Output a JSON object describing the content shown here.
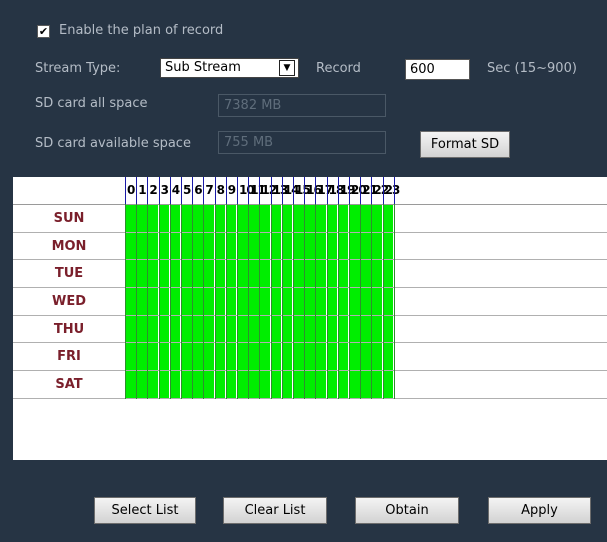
{
  "enable_label": "Enable the plan of record",
  "enable_checked": true,
  "stream_label": "Stream Type:",
  "stream_value": "Sub Stream",
  "record_label": "Record",
  "record_value": "600",
  "sec_label": "Sec (15~900)",
  "sd_all_label": "SD card all space",
  "sd_all_value": "7382 MB",
  "sd_avail_label": "SD card available space",
  "sd_avail_value": "755 MB",
  "format_button": "Format SD",
  "days": [
    "SUN",
    "MON",
    "TUE",
    "WED",
    "THU",
    "FRI",
    "SAT"
  ],
  "hours": [
    "0",
    "1",
    "2",
    "3",
    "4",
    "5",
    "6",
    "7",
    "8",
    "9",
    "10",
    "11",
    "12",
    "13",
    "14",
    "15",
    "16",
    "17",
    "18",
    "19",
    "20",
    "21",
    "22",
    "23"
  ],
  "selected_all": true,
  "colors": {
    "selected": "#00ee00",
    "background": "#263444"
  },
  "buttons": {
    "select_list": "Select List",
    "clear_list": "Clear List",
    "obtain": "Obtain",
    "apply": "Apply"
  }
}
